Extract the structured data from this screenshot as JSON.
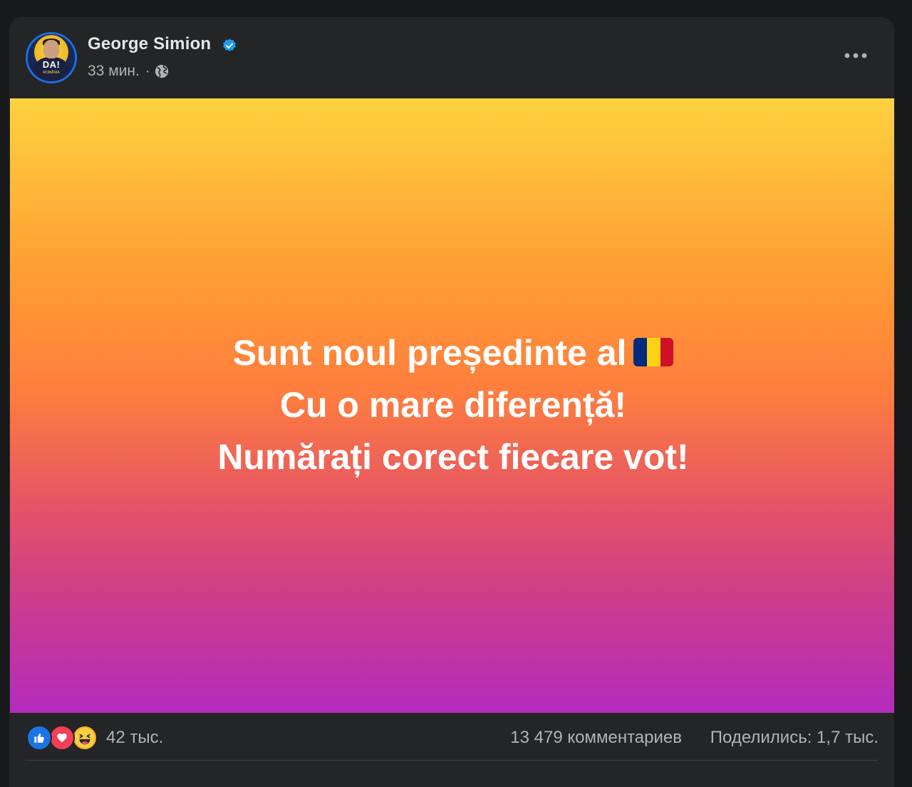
{
  "post": {
    "author": {
      "name": "George Simion",
      "verified": true,
      "avatar_text": "DA!",
      "avatar_subtext": "ROMÂNIA"
    },
    "meta": {
      "time": "33 мин.",
      "separator": "·",
      "audience_icon": "globe-icon"
    },
    "more_icon": "more-horizontal-icon",
    "content": {
      "lines": [
        "Sunt noul președinte al",
        "Cu o mare diferență!",
        "Numărați corect fiecare vot!"
      ],
      "flag_emoji": "romania-flag-icon",
      "flag_colors": [
        "#002b7f",
        "#fcd116",
        "#ce1126"
      ],
      "gradient_colors": [
        "#fed23f",
        "#ff9e33",
        "#ff7d3e",
        "#e2506a",
        "#c83a92",
        "#b52bbd"
      ]
    },
    "stats": {
      "reaction_icons": [
        "like-icon",
        "love-icon",
        "haha-icon"
      ],
      "reactions": "42 тыс.",
      "comments": "13 479 комментариев",
      "shares": "Поделились: 1,7 тыс."
    }
  },
  "colors": {
    "page_bg": "#18191a",
    "card_bg": "#242526",
    "primary_text": "#e4e6eb",
    "secondary_text": "#b0b3b8",
    "verified_blue": "#1d9bf0"
  }
}
